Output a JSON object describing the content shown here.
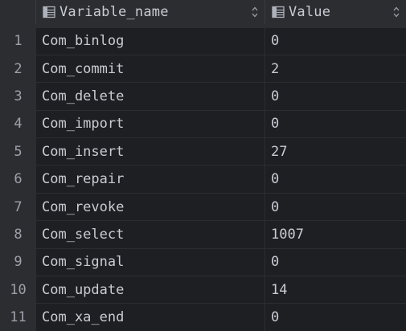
{
  "columns": {
    "name_header": "Variable_name",
    "value_header": "Value",
    "header_icon": "table-column-icon",
    "sort_icon": "sort-arrows-icon"
  },
  "rows": [
    {
      "num": "1",
      "name": "Com_binlog",
      "value": "0"
    },
    {
      "num": "2",
      "name": "Com_commit",
      "value": "2"
    },
    {
      "num": "3",
      "name": "Com_delete",
      "value": "0"
    },
    {
      "num": "4",
      "name": "Com_import",
      "value": "0"
    },
    {
      "num": "5",
      "name": "Com_insert",
      "value": "27"
    },
    {
      "num": "6",
      "name": "Com_repair",
      "value": "0"
    },
    {
      "num": "7",
      "name": "Com_revoke",
      "value": "0"
    },
    {
      "num": "8",
      "name": "Com_select",
      "value": "1007"
    },
    {
      "num": "9",
      "name": "Com_signal",
      "value": "0"
    },
    {
      "num": "10",
      "name": "Com_update",
      "value": "14"
    },
    {
      "num": "11",
      "name": "Com_xa_end",
      "value": "0"
    }
  ],
  "colors": {
    "background": "#2b2d30",
    "cell_background": "#1e1f22",
    "text": "#c9ccd3",
    "row_number": "#9da0a8"
  }
}
